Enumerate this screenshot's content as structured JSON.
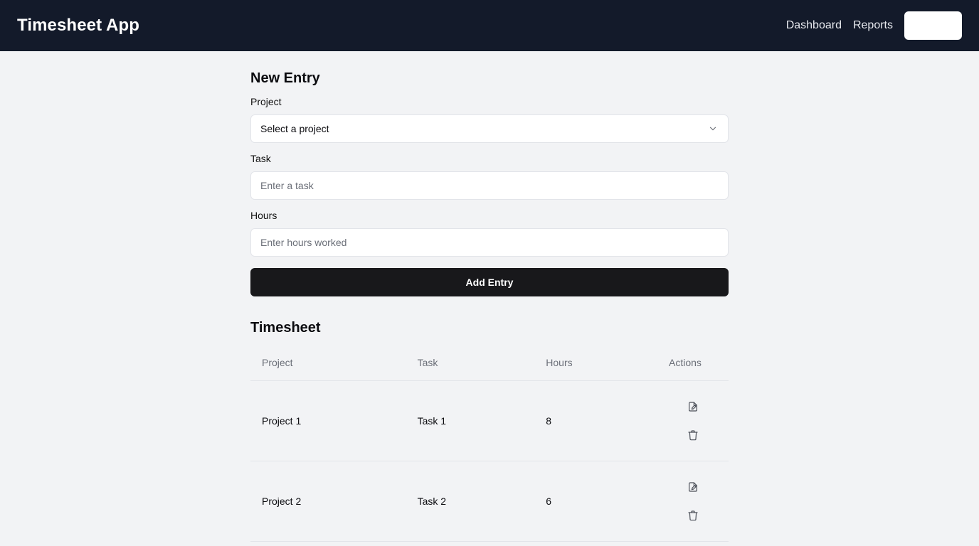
{
  "app": {
    "title": "Timesheet App"
  },
  "nav": {
    "items": [
      {
        "label": "Dashboard"
      },
      {
        "label": "Reports"
      }
    ],
    "button_label": ""
  },
  "form": {
    "title": "New Entry",
    "project": {
      "label": "Project",
      "selected": "Select a project"
    },
    "task": {
      "label": "Task",
      "placeholder": "Enter a task"
    },
    "hours": {
      "label": "Hours",
      "placeholder": "Enter hours worked"
    },
    "submit_label": "Add Entry"
  },
  "timesheet": {
    "title": "Timesheet",
    "columns": [
      "Project",
      "Task",
      "Hours",
      "Actions"
    ],
    "rows": [
      {
        "project": "Project 1",
        "task": "Task 1",
        "hours": "8"
      },
      {
        "project": "Project 2",
        "task": "Task 2",
        "hours": "6"
      }
    ]
  },
  "icons": {
    "select_chevron": "chevron-down-icon",
    "edit": "file-edit-icon",
    "delete": "trash-icon"
  }
}
